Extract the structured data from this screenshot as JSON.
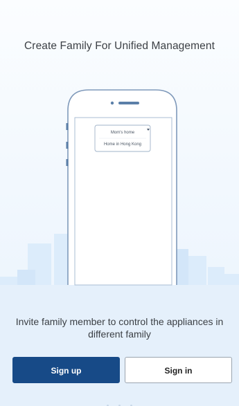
{
  "onboarding": {
    "headline": "Create Family For Unified Management",
    "family_menu": {
      "items": [
        "Mom's home",
        "Home in Hong Kong"
      ]
    },
    "caption": "Invite family member to control the appliances in different family",
    "sign_up_label": "Sign up",
    "sign_in_label": "Sign in",
    "page_indicator": {
      "total": 3
    }
  },
  "colors": {
    "primary_button": "#174a87",
    "skyline": "#d3e6f9",
    "phone_outline": "#7f99ba"
  }
}
